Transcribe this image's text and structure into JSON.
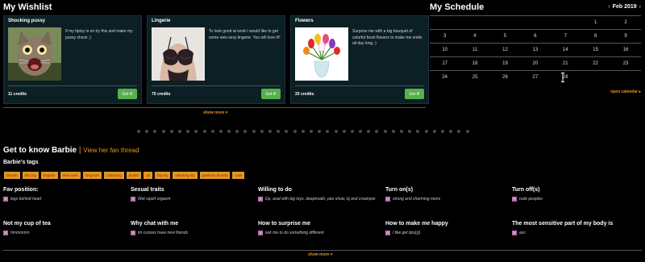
{
  "wishlist": {
    "title": "My Wishlist",
    "items": [
      {
        "title": "Shocking pussy",
        "desc": "If my tiptoy is on try this and make my pussy shock ;)",
        "credits": "11 credits",
        "button": "Get it!"
      },
      {
        "title": "Lingerie",
        "desc": "To look good at work I would like to get some new sexy lingerie. You will love it!!",
        "credits": "75 credits",
        "button": "Get it!"
      },
      {
        "title": "Flowers",
        "desc": "Surprise me with a big bouquet of colorful fresh flowers to make me smile all day long :)",
        "credits": "20 credits",
        "button": "Get it!"
      }
    ],
    "show_more": "show more ▾"
  },
  "schedule": {
    "title": "My Schedule",
    "month": "Feb 2019",
    "prev_arrow": "‹",
    "next_arrow": "›",
    "weeks": [
      [
        "",
        "",
        "",
        "",
        "",
        "1",
        "2"
      ],
      [
        "3",
        "4",
        "5",
        "6",
        "7",
        "8",
        "9"
      ],
      [
        "10",
        "11",
        "12",
        "13",
        "14",
        "15",
        "16"
      ],
      [
        "17",
        "18",
        "19",
        "20",
        "21",
        "22",
        "23"
      ],
      [
        "24",
        "25",
        "26",
        "27",
        "28",
        "",
        ""
      ]
    ],
    "open_calendar": "open calendar ▸"
  },
  "about": {
    "title": "Get to know Barbie",
    "pipe": "|",
    "fan_link": "View her fan thread",
    "tags_heading": "Barbie's tags",
    "tags": [
      "blonde",
      "bbc toy",
      "lingerie",
      "blue eyes",
      "long hair",
      "charming",
      "teaser",
      "18",
      "big toy",
      "vibrating toy",
      "platinum blonde",
      "cute"
    ],
    "questions": [
      {
        "label": "Fav position:",
        "answer": "legs behind head"
      },
      {
        "label": "Sexual traits",
        "answer": "Wet squirt orgazm"
      },
      {
        "label": "Willing to do",
        "answer": "Dp, anal with big toys, deeptroath, pee show, bj and creampie"
      },
      {
        "label": "Turn on(s)",
        "answer": "strong and charming mens"
      },
      {
        "label": "Turn off(s)",
        "answer": "rude peoples"
      },
      {
        "label": "Not my cup of tea",
        "answer": "hmmmmm"
      },
      {
        "label": "Why chat with me",
        "answer": "im curious have new friends"
      },
      {
        "label": "How to surprise me",
        "answer": "ask me to do something different"
      },
      {
        "label": "How to make me happy",
        "answer": "I like get tips))))"
      },
      {
        "label": "The most sensitive part of my body is",
        "answer": "ass"
      }
    ],
    "badge_letter": "A",
    "show_more": "show more ▾"
  },
  "colors": {
    "accent": "#e39623",
    "button_green": "#56b04e",
    "card_bg": "#0c1f24",
    "badge": "#b96fa8"
  }
}
